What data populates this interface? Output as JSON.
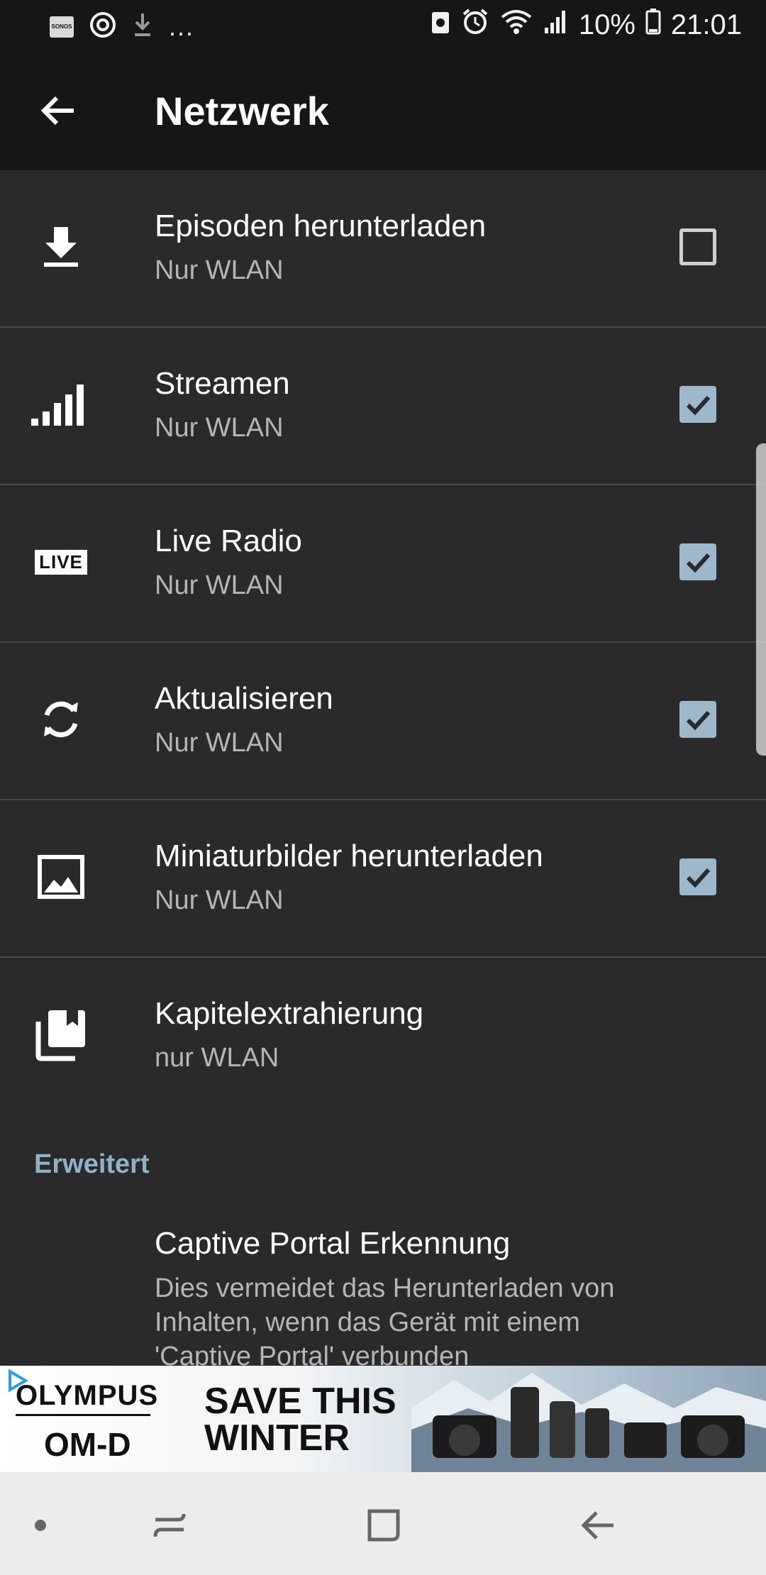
{
  "status_bar": {
    "left_icons": [
      "sonos-icon",
      "pocket-casts-icon",
      "download-icon"
    ],
    "overflow": "...",
    "right_icons": [
      "recycle-icon",
      "alarm-icon",
      "wifi-icon",
      "signal-icon"
    ],
    "battery_percent": "10%",
    "time": "21:01"
  },
  "app_bar": {
    "back_icon": "arrow-back-icon",
    "title": "Netzwerk"
  },
  "settings": [
    {
      "icon": "download-icon",
      "title": "Episoden herunterladen",
      "subtitle": "Nur WLAN",
      "checked": false
    },
    {
      "icon": "signal-bars-icon",
      "title": "Streamen",
      "subtitle": "Nur WLAN",
      "checked": true
    },
    {
      "icon": "live-badge-icon",
      "icon_text": "LIVE",
      "title": "Live Radio",
      "subtitle": "Nur WLAN",
      "checked": true
    },
    {
      "icon": "sync-icon",
      "title": "Aktualisieren",
      "subtitle": "Nur WLAN",
      "checked": true
    },
    {
      "icon": "image-icon",
      "title": "Miniaturbilder herunterladen",
      "subtitle": "Nur WLAN",
      "checked": true
    },
    {
      "icon": "bookmarks-icon",
      "title": "Kapitelextrahierung",
      "subtitle": "nur WLAN"
    }
  ],
  "advanced": {
    "header": "Erweitert",
    "captive_portal": {
      "title": "Captive Portal Erkennung",
      "description": "Dies vermeidet das Herunterladen von Inhalten, wenn das Gerät mit einem 'Captive Portal' verbunden"
    }
  },
  "ad": {
    "brand": "OLYMPUS",
    "product": "OM-D",
    "headline_line1": "SAVE THIS",
    "headline_line2": "WINTER"
  },
  "nav_bar": {
    "items": [
      "dot-icon",
      "recent-apps-icon",
      "home-icon",
      "back-icon"
    ]
  },
  "colors": {
    "background": "#2a2a2c",
    "app_bar": "#161616",
    "accent": "#8fb2c9",
    "checkbox_checked": "#9db7cb"
  }
}
